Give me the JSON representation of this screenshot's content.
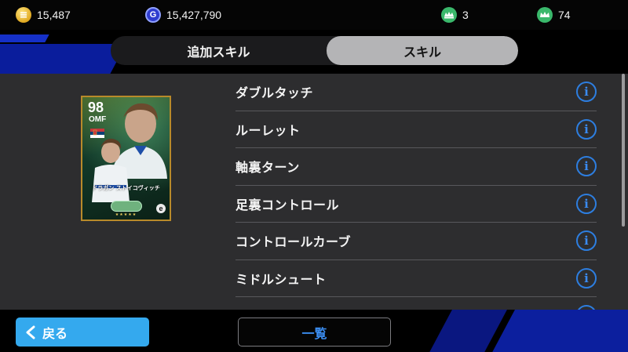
{
  "currencies": {
    "coins": "15,487",
    "gp": "15,427,790",
    "gp_symbol": "G",
    "tickets_a": "3",
    "tickets_b": "74"
  },
  "tabs": [
    {
      "label": "追加スキル",
      "selected": false
    },
    {
      "label": "スキル",
      "selected": true
    }
  ],
  "player_card": {
    "rating": "98",
    "position": "OMF",
    "name": "ドラガン ストイコヴィッチ",
    "nation_flag": "serbia-flag-icon",
    "stars": "★★★★★",
    "brand_logo": "e"
  },
  "skills": [
    {
      "label": "ダブルタッチ",
      "icon": "info-icon"
    },
    {
      "label": "ルーレット",
      "icon": "info-icon"
    },
    {
      "label": "軸裏ターン",
      "icon": "info-icon"
    },
    {
      "label": "足裏コントロール",
      "icon": "info-icon"
    },
    {
      "label": "コントロールカーブ",
      "icon": "info-icon"
    },
    {
      "label": "ミドルシュート",
      "icon": "info-icon"
    },
    {
      "label": "",
      "icon": "info-icon"
    }
  ],
  "info_glyph": "i",
  "footer": {
    "back_label": "戻る",
    "list_label": "一覧"
  },
  "colors": {
    "accent_blue": "#34a9ee",
    "info_blue": "#2d7ee0",
    "selected_tab": "#b4b4b6"
  }
}
